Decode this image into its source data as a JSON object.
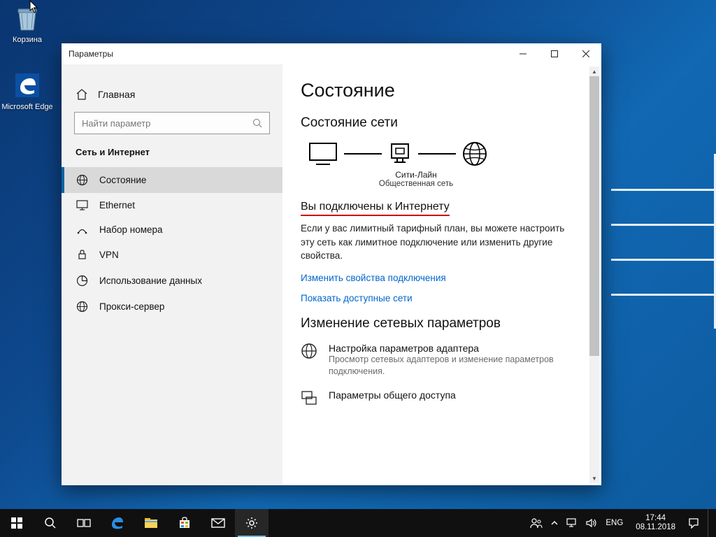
{
  "desktop": {
    "recycle_label": "Корзина",
    "edge_label": "Microsoft Edge"
  },
  "window": {
    "title": "Параметры",
    "home_label": "Главная",
    "search_placeholder": "Найти параметр",
    "section_label": "Сеть и Интернет",
    "nav": [
      {
        "label": "Состояние"
      },
      {
        "label": "Ethernet"
      },
      {
        "label": "Набор номера"
      },
      {
        "label": "VPN"
      },
      {
        "label": "Использование данных"
      },
      {
        "label": "Прокси-сервер"
      }
    ]
  },
  "content": {
    "h1": "Состояние",
    "h2": "Состояние сети",
    "diagram_name": "Сити-Лайн",
    "diagram_type": "Общественная сеть",
    "connected_heading": "Вы подключены к Интернету",
    "connected_para": "Если у вас лимитный тарифный план, вы можете настроить эту сеть как лимитное подключение или изменить другие свойства.",
    "link_change_props": "Изменить свойства подключения",
    "link_show_networks": "Показать доступные сети",
    "h3": "Изменение сетевых параметров",
    "opt1_title": "Настройка параметров адаптера",
    "opt1_desc": "Просмотр сетевых адаптеров и изменение параметров подключения.",
    "opt2_title": "Параметры общего доступа"
  },
  "taskbar": {
    "lang": "ENG",
    "time": "17:44",
    "date": "08.11.2018"
  }
}
